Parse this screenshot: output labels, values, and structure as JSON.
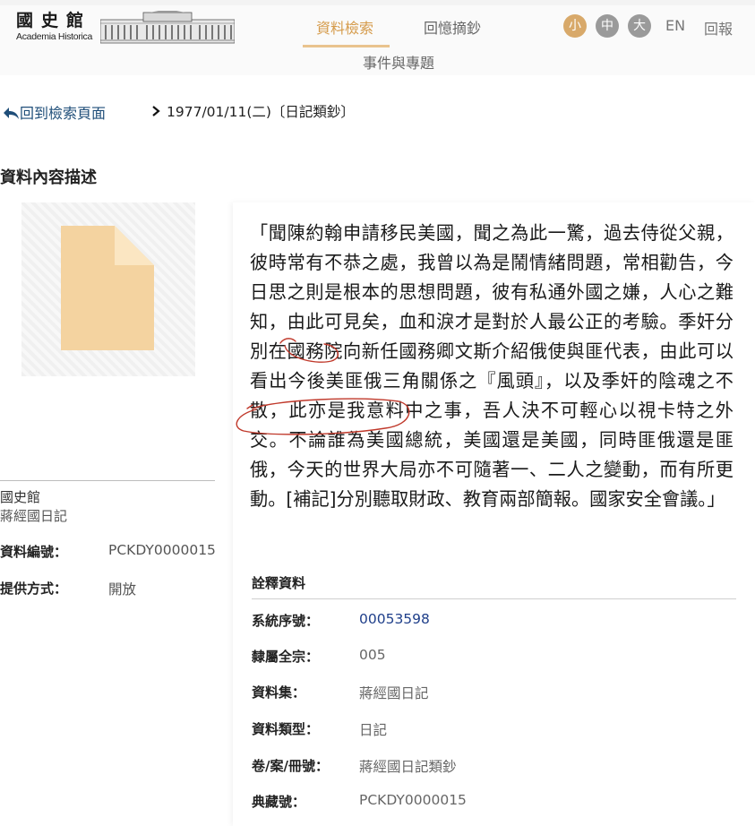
{
  "header": {
    "logo_zh": "國史館",
    "logo_en": "Academia Historica",
    "nav": {
      "search": "資料檢索",
      "memoir": "回憶摘鈔",
      "events": "事件與專題"
    },
    "font_sizes": {
      "small": "小",
      "medium": "中",
      "large": "大"
    },
    "lang": "EN",
    "feedback": "回報"
  },
  "breadcrumb": {
    "back": "回到檢索頁面",
    "current": "1977/01/11(二)〔日記類鈔〕"
  },
  "section_title": "資料內容描述",
  "sidebar": {
    "org": "國史館",
    "collection": "蔣經國日記",
    "fields": [
      {
        "label": "資料編號：",
        "value": "PCKDY0000015"
      },
      {
        "label": "提供方式：",
        "value": "開放"
      }
    ]
  },
  "content": {
    "text_p1": "「聞陳約翰申請移民美國，聞之為此一驚，過去侍從父親，彼時常有不恭之處，我曾以為是鬧情緒問題，常相勸告，今日思之則是根本的思想問題，彼有私通外國之嫌，人心之難知，由此可見矣，血和淚才是對於人最公正的考驗。",
    "hl1": "季奸",
    "text_p2": "分別在國務院向新任國務卿文斯介紹俄使與匪代表，由此可以看出今後美匪俄三角關係之『風頭』，以及",
    "hl2": "季奸的陰魂之不散",
    "text_p3": "，此亦是我意料中之事，吾人決不可輕心以視卡特之外交。不論誰為美國總統，美國還是美國，同時匪俄還是匪俄，今天的世界大局亦不可隨著一、二人之變動，而有所更動。[補記]分別聽取財政、教育兩部簡報。國家安全會議。」"
  },
  "annotation": {
    "title": "詮釋資料",
    "fields": [
      {
        "label": "系統序號：",
        "value": "00053598"
      },
      {
        "label": "隸屬全宗：",
        "value": "005"
      },
      {
        "label": "資料集：",
        "value": "蔣經國日記"
      },
      {
        "label": "資料類型：",
        "value": "日記"
      },
      {
        "label": "卷/案/冊號：",
        "value": "蔣經國日記類鈔"
      },
      {
        "label": "典藏號：",
        "value": "PCKDY0000015"
      }
    ]
  },
  "colors": {
    "accent": "#d59a49",
    "link": "#1f4e79",
    "annotation_ink": "#c0392b"
  }
}
